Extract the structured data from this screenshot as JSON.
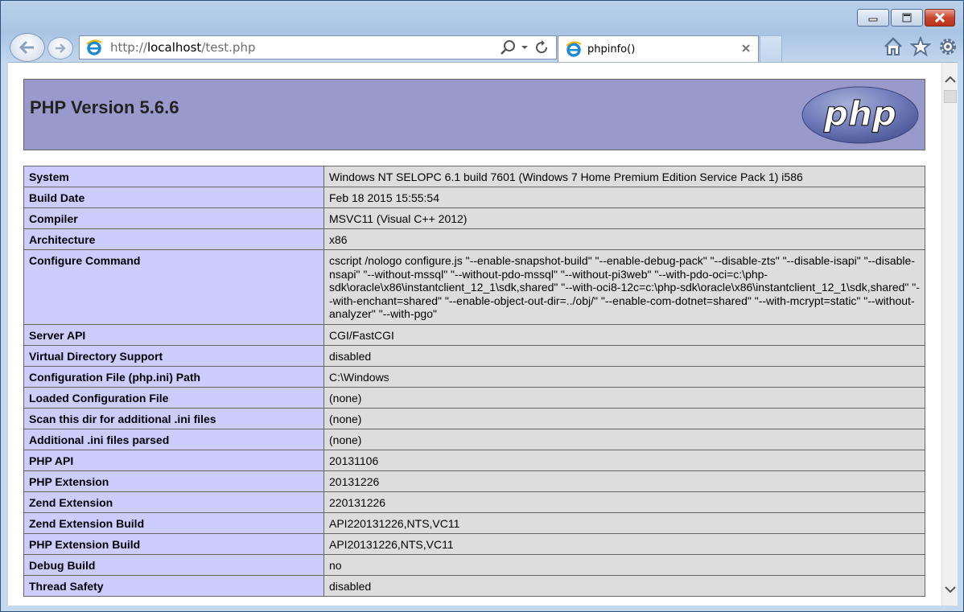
{
  "browser": {
    "address": {
      "prefix": "http://",
      "host": "localhost",
      "path": "/test.php"
    },
    "tab": {
      "title": "phpinfo()"
    },
    "colors": {
      "frame": "#a9c4e4",
      "close": "#c8442d"
    }
  },
  "page": {
    "title": "PHP Version 5.6.6",
    "logo_text": "php",
    "colors": {
      "header": "#9999cc",
      "key": "#ccccff",
      "value": "#dddddd"
    },
    "rows": [
      {
        "key": "System",
        "value": "Windows NT SELOPC 6.1 build 7601 (Windows 7 Home Premium Edition Service Pack 1) i586"
      },
      {
        "key": "Build Date",
        "value": "Feb 18 2015 15:55:54"
      },
      {
        "key": "Compiler",
        "value": "MSVC11 (Visual C++ 2012)"
      },
      {
        "key": "Architecture",
        "value": "x86"
      },
      {
        "key": "Configure Command",
        "value": "cscript /nologo configure.js \"--enable-snapshot-build\" \"--enable-debug-pack\" \"--disable-zts\" \"--disable-isapi\" \"--disable-nsapi\" \"--without-mssql\" \"--without-pdo-mssql\" \"--without-pi3web\" \"--with-pdo-oci=c:\\php-sdk\\oracle\\x86\\instantclient_12_1\\sdk,shared\" \"--with-oci8-12c=c:\\php-sdk\\oracle\\x86\\instantclient_12_1\\sdk,shared\" \"--with-enchant=shared\" \"--enable-object-out-dir=../obj/\" \"--enable-com-dotnet=shared\" \"--with-mcrypt=static\" \"--without-analyzer\" \"--with-pgo\""
      },
      {
        "key": "Server API",
        "value": "CGI/FastCGI"
      },
      {
        "key": "Virtual Directory Support",
        "value": "disabled"
      },
      {
        "key": "Configuration File (php.ini) Path",
        "value": "C:\\Windows"
      },
      {
        "key": "Loaded Configuration File",
        "value": "(none)"
      },
      {
        "key": "Scan this dir for additional .ini files",
        "value": "(none)"
      },
      {
        "key": "Additional .ini files parsed",
        "value": "(none)"
      },
      {
        "key": "PHP API",
        "value": "20131106"
      },
      {
        "key": "PHP Extension",
        "value": "20131226"
      },
      {
        "key": "Zend Extension",
        "value": "220131226"
      },
      {
        "key": "Zend Extension Build",
        "value": "API220131226,NTS,VC11"
      },
      {
        "key": "PHP Extension Build",
        "value": "API20131226,NTS,VC11"
      },
      {
        "key": "Debug Build",
        "value": "no"
      },
      {
        "key": "Thread Safety",
        "value": "disabled"
      }
    ]
  }
}
